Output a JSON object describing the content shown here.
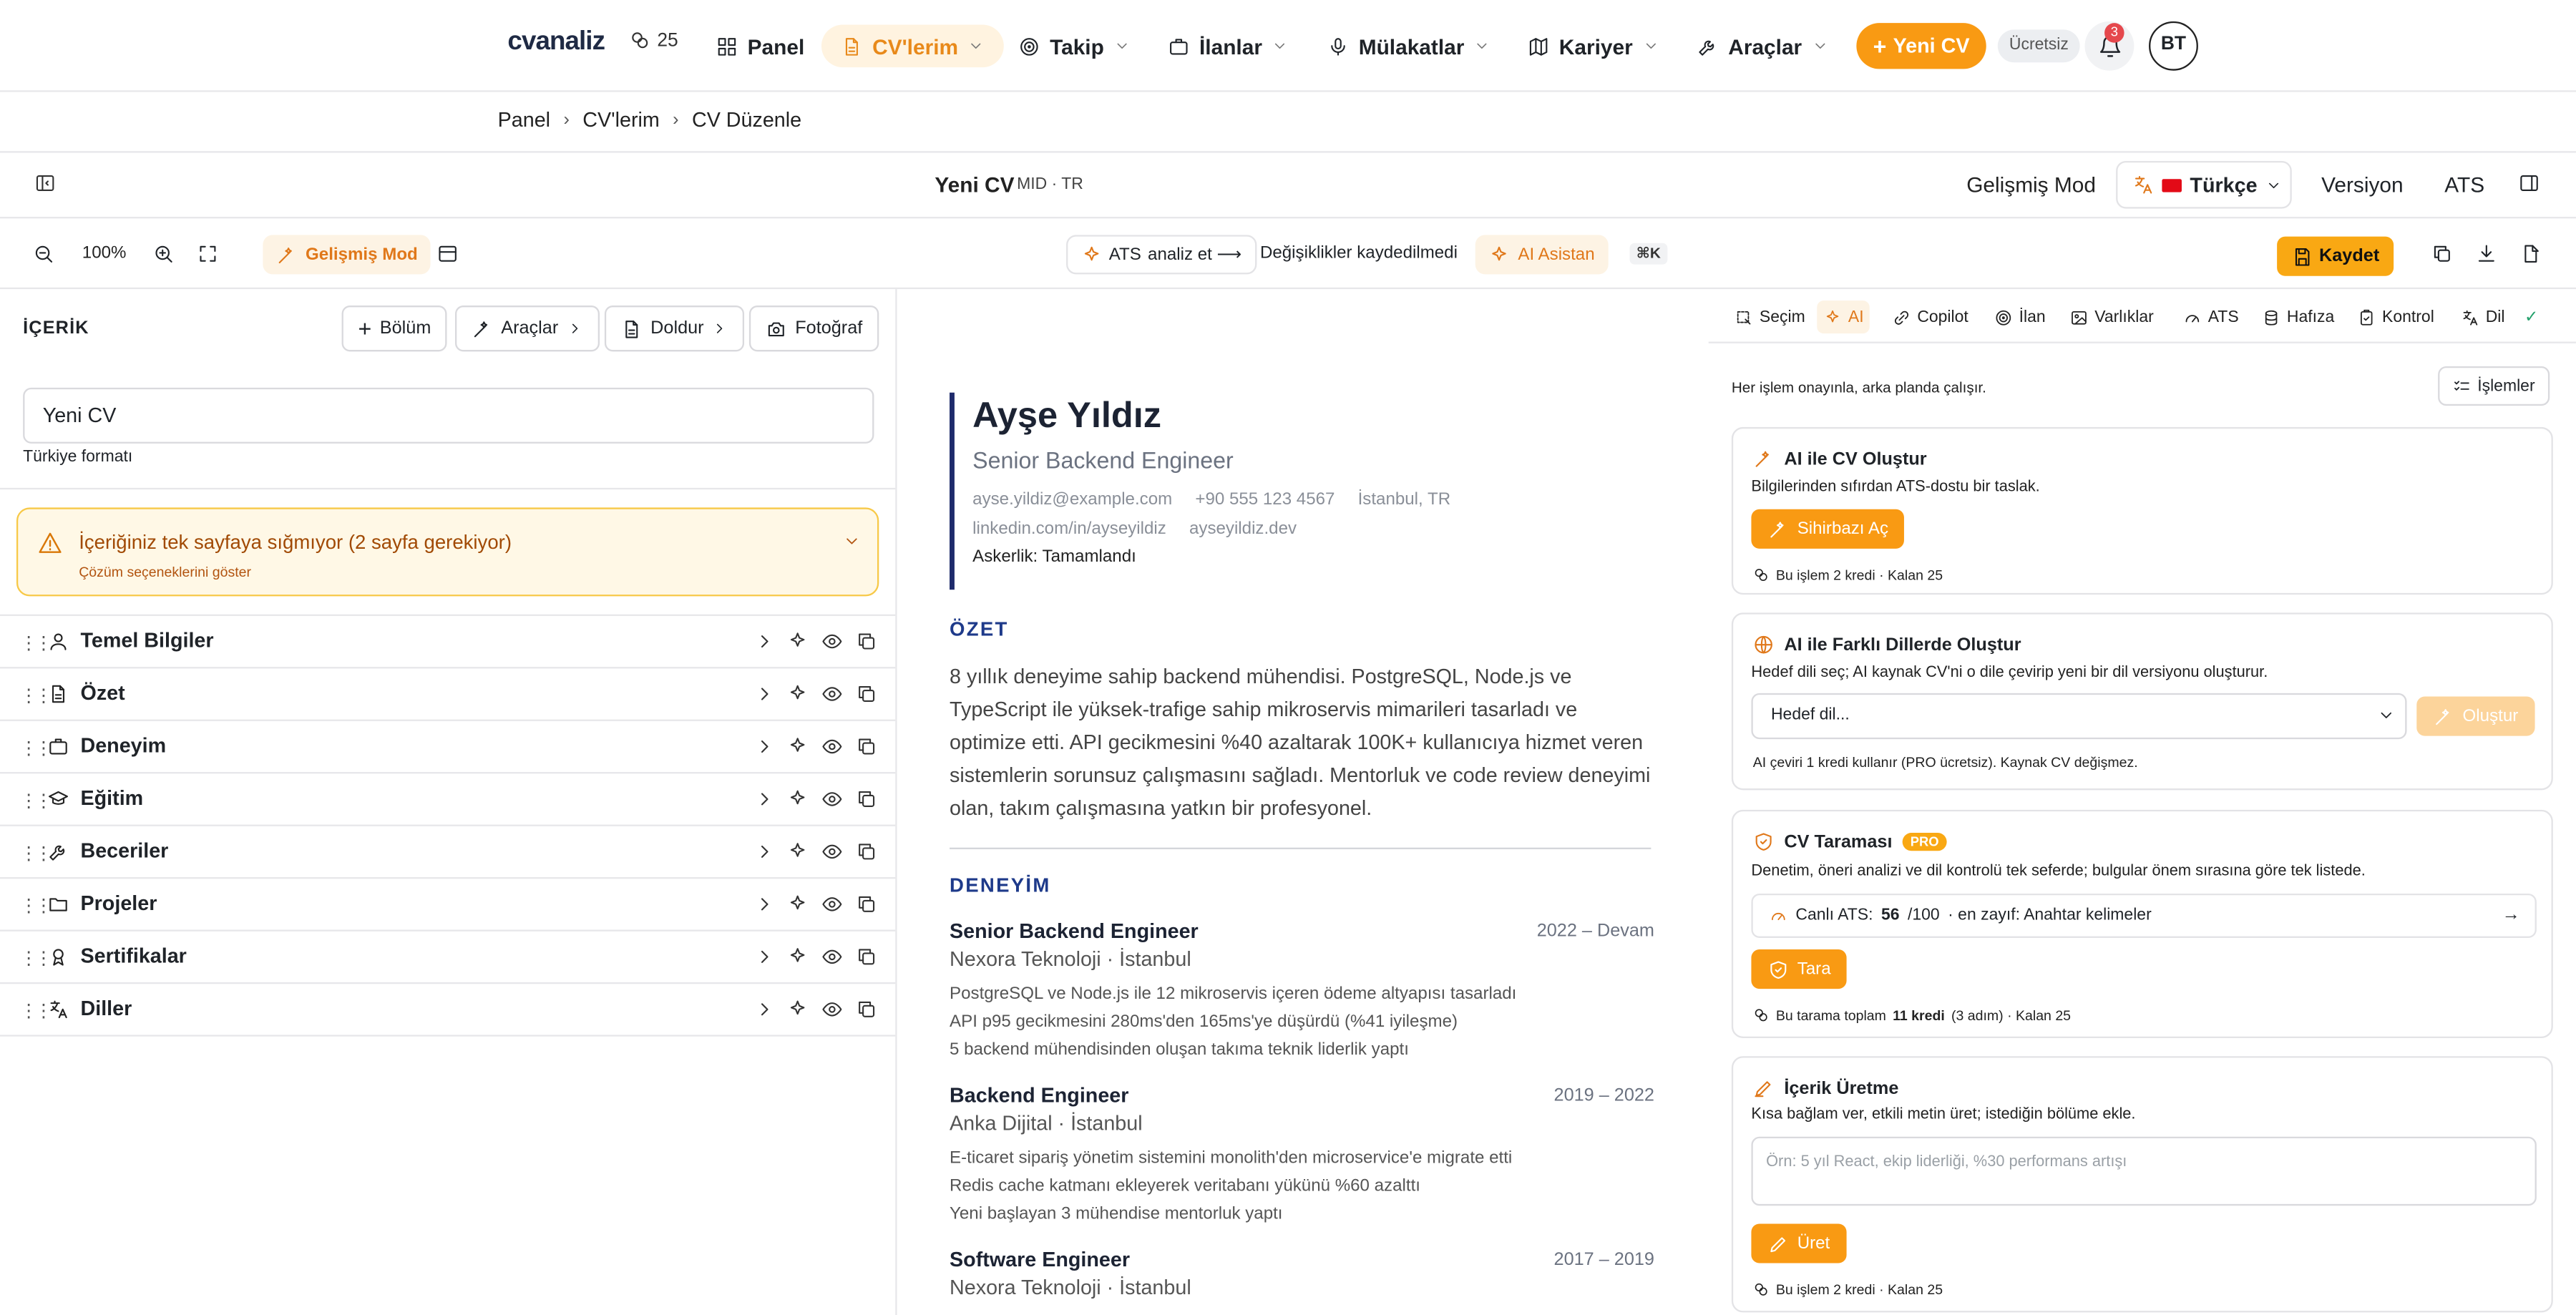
{
  "topnav": {
    "logo": "cvanaliz",
    "credits": "25",
    "items": [
      {
        "label": "Panel"
      },
      {
        "label": "CV'lerim"
      },
      {
        "label": "Takip"
      },
      {
        "label": "İlanlar"
      },
      {
        "label": "Mülakatlar"
      },
      {
        "label": "Kariyer"
      },
      {
        "label": "Araçlar"
      }
    ],
    "new_cv": "Yeni CV",
    "plan": "Ücretsiz",
    "notifications": "3",
    "avatar": "BT",
    "accent": "#f99a13"
  },
  "breadcrumb": [
    "Panel",
    "CV'lerim",
    "CV Düzenle"
  ],
  "doc_header": {
    "title": "Yeni CV",
    "meta": "MID · TR",
    "advanced_mode": "Gelişmiş Mod",
    "language": "Türkçe",
    "version": "Versiyon",
    "ats": "ATS"
  },
  "toolbar": {
    "zoom": "100%",
    "advanced_mode": "Gelişmiş Mod",
    "ats_label": "ATS",
    "ats_action": "analiz et ⟶",
    "unsaved": "Değişiklikler kaydedilmedi",
    "ai_assistant": "AI Asistan",
    "shortcut": "⌘K",
    "save": "Kaydet"
  },
  "left": {
    "heading": "İÇERİK",
    "buttons": {
      "section": "Bölüm",
      "tools": "Araçlar",
      "fill": "Doldur",
      "photo": "Fotoğraf"
    },
    "cv_name": "Yeni CV",
    "format": "Türkiye formatı",
    "warning_title": "İçeriğiniz tek sayfaya sığmıyor (2 sayfa gerekiyor)",
    "warning_sub": "Çözüm seçeneklerini göster",
    "sections": [
      {
        "label": "Temel Bilgiler",
        "icon": "user-icon"
      },
      {
        "label": "Özet",
        "icon": "document-icon"
      },
      {
        "label": "Deneyim",
        "icon": "briefcase-icon"
      },
      {
        "label": "Eğitim",
        "icon": "graduation-cap-icon"
      },
      {
        "label": "Beceriler",
        "icon": "wrench-icon"
      },
      {
        "label": "Projeler",
        "icon": "folder-icon"
      },
      {
        "label": "Sertifikalar",
        "icon": "award-icon"
      },
      {
        "label": "Diller",
        "icon": "languages-icon"
      }
    ]
  },
  "preview": {
    "name": "Ayşe Yıldız",
    "role": "Senior Backend Engineer",
    "email": "ayse.yildiz@example.com",
    "phone": "+90 555 123 4567",
    "location": "İstanbul, TR",
    "linkedin": "linkedin.com/in/ayseyildiz",
    "website": "ayseyildiz.dev",
    "military": "Askerlik: Tamamlandı",
    "summary_heading": "ÖZET",
    "summary": "8 yıllık deneyime sahip backend mühendisi. PostgreSQL, Node.js ve TypeScript ile yüksek-trafige sahip mikroservis mimarileri tasarladı ve optimize etti. API gecikmesini %40 azaltarak 100K+ kullanıcıya hizmet veren sistemlerin sorunsuz çalışmasını sağladı. Mentorluk ve code review deneyimi olan, takım çalışmasına yatkın bir profesyonel.",
    "experience_heading": "DENEYİM",
    "jobs": [
      {
        "title": "Senior Backend Engineer",
        "dates": "2022 – Devam",
        "company": "Nexora Teknoloji · İstanbul",
        "bullets": [
          "PostgreSQL ve Node.js ile 12 mikroservis içeren ödeme altyapısı tasarladı",
          "API p95 gecikmesini 280ms'den 165ms'ye düşürdü (%41 iyileşme)",
          "5 backend mühendisinden oluşan takıma teknik liderlik yaptı"
        ]
      },
      {
        "title": "Backend Engineer",
        "dates": "2019 – 2022",
        "company": "Anka Dijital · İstanbul",
        "bullets": [
          "E-ticaret sipariş yönetim sistemini monolith'den microservice'e migrate etti",
          "Redis cache katmanı ekleyerek veritabanı yükünü %60 azalttı",
          "Yeni başlayan 3 mühendise mentorluk yaptı"
        ]
      },
      {
        "title": "Software Engineer",
        "dates": "2017 – 2019",
        "company": "Nexora Teknoloji · İstanbul",
        "bullets": []
      }
    ]
  },
  "right": {
    "tabs": [
      {
        "label": "Seçim",
        "icon": "selection-icon"
      },
      {
        "label": "AI",
        "icon": "sparkles-icon"
      },
      {
        "label": "Copilot",
        "icon": "copilot-icon"
      },
      {
        "label": "İlan",
        "icon": "target-icon"
      },
      {
        "label": "Varlıklar",
        "icon": "image-icon"
      },
      {
        "label": "ATS",
        "icon": "gauge-icon"
      },
      {
        "label": "Hafıza",
        "icon": "database-icon"
      },
      {
        "label": "Kontrol",
        "icon": "clipboard-check-icon"
      },
      {
        "label": "Dil",
        "icon": "languages-icon"
      }
    ],
    "note": "Her işlem onayınla, arka planda çalışır.",
    "ops": "İşlemler",
    "cards": {
      "create": {
        "title": "AI ile CV Oluştur",
        "desc": "Bilgilerinden sıfırdan ATS-dostu bir taslak.",
        "button": "Sihirbazı Aç",
        "footer": "Bu işlem 2 kredi · Kalan 25"
      },
      "translate": {
        "title": "AI ile Farklı Dillerde Oluştur",
        "desc": "Hedef dili seç; AI kaynak CV'ni o dile çevirip yeni bir dil versiyonu oluşturur.",
        "select": "Hedef dil...",
        "button": "Oluştur",
        "footer": "AI çeviri 1 kredi kullanır (PRO ücretsiz). Kaynak CV değişmez."
      },
      "scan": {
        "title": "CV Taraması",
        "badge": "PRO",
        "desc": "Denetim, öneri analizi ve dil kontrolü tek seferde; bulgular önem sırasına göre tek listede.",
        "ats_label": "Canlı ATS:",
        "ats_score": "56",
        "ats_max": "/100",
        "ats_weak": "· en zayıf: Anahtar kelimeler",
        "button": "Tara",
        "footer_pre": "Bu tarama toplam",
        "footer_bold": "11 kredi",
        "footer_post": "(3 adım) · Kalan 25"
      },
      "generate": {
        "title": "İçerik Üretme",
        "desc": "Kısa bağlam ver, etkili metin üret; istediğin bölüme ekle.",
        "placeholder": "Örn: 5 yıl React, ekip liderliği, %30 performans artışı",
        "button": "Üret",
        "footer": "Bu işlem 2 kredi · Kalan 25"
      }
    }
  }
}
